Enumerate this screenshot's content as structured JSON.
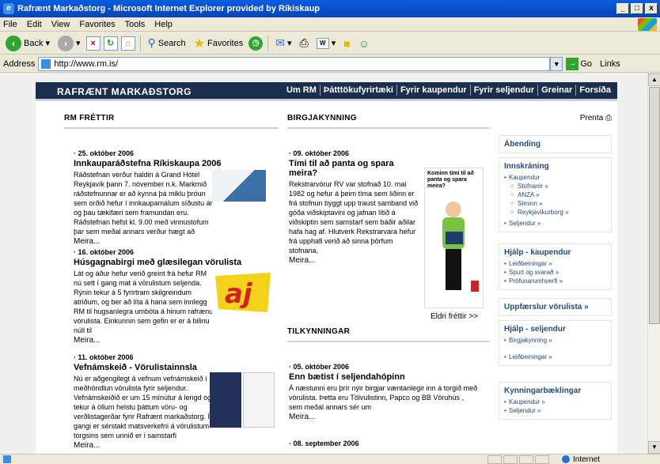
{
  "window": {
    "title": "Rafrænt Markaðstorg - Microsoft Internet Explorer provided by Ríkiskaup"
  },
  "menus": [
    "File",
    "Edit",
    "View",
    "Favorites",
    "Tools",
    "Help"
  ],
  "toolbar": {
    "back": "Back",
    "search": "Search",
    "favorites": "Favorites"
  },
  "address": {
    "label": "Address",
    "url": "http://www.rm.is/",
    "go": "Go",
    "links": "Links"
  },
  "status": {
    "zone": "Internet"
  },
  "site": {
    "name": "RAFRÆNT MARKAÐSTORG",
    "nav": [
      "Um RM",
      "Þátttökufyrirtæki",
      "Fyrir kaupendur",
      "Fyrir seljendur",
      "Greinar",
      "Forsíða"
    ]
  },
  "news": {
    "heading": "RM FRÉTTIR",
    "items": [
      {
        "date": "· 25. október 2006",
        "title": "Innkauparáðstefna Ríkiskaupa 2006",
        "body": "Ráðstefnan verður haldin á Grand Hótel Reykjavík þann 7. nóvember n.k. Markmið ráðstefnunnar er að kynna þá miklu þróun sem orðið hefur í innkaupamálum síðustu ár og þau tækifæri sem framundan eru. Ráðstefnan hefst kl. 9.00 með vinnustofum þar sem meðal annars verður hægt að",
        "more": "Meira..."
      },
      {
        "date": "· 16. október 2006",
        "title": "Húsgagnabirgi með glæsilegan vörulista",
        "body": "Lát og áður hefur verið greint frá hefur RM nú sett í gang mat á vörulistum seljenda. Rýnin tekur á 5 fyrirtram skilgreindum atriðum, og ber að líta á hana sem innlegg RM til hugsanlegra umbóta á hinum rafrænu vörulista. Einkunnin sem gefin er er á bilinu núll til",
        "more": "Meira..."
      },
      {
        "date": "· 11. október 2006",
        "title": "Vefnámskeið - Vörulistainnsla",
        "body": "Nú er aðgengilegt á vefnum vefnámskeið í meðhöndlun vörulista fyrir seljendur. Vefnámskeiðið er um 15 mínútur á lengd og tekur á öllum helstu þáttum vöru- og verðlistagerðar fyrir Rafrænt markaðstorg. Í gangi er sérstakt matsverkefni á vörulistum torgsins sem unnið er í samstarfi",
        "more": "Meira..."
      }
    ]
  },
  "birgja": {
    "heading": "BIRGJAKYNNING",
    "date": "· 09. október 2006",
    "title": "Tími til að panta og spara meira?",
    "body": "Rekstrarvörur RV var stofnað 10. maí 1982 og hefur á þeim tíma sem liðinn er frá stofnun byggt upp traust samband við góða viðskiptavini og jafnan lítið á viðskiptin sem samstarf sem báðir aðilar hafa hag af. Hlutverk Rekstrarvara hefur frá upphafi verið að sinna þörfum stofnana,",
    "more": "Meira...",
    "ad_text": "Kominn tími til að panta og spara meira?",
    "older": "Eldri fréttir >>"
  },
  "tilkynningar": {
    "heading": "TILKYNNINGAR",
    "items": [
      {
        "date": "· 05. október 2006",
        "title": "Enn bætist í seljendahópinn",
        "body": "Á næstunni eru þrír nýir birgjar væntanlegir inn á torgið með vörulista. Þetta eru Tölvulistinn, Papco og BB Vöruhús , sem meðal annars sér um",
        "more": "Meira..."
      },
      {
        "date": "· 08. september 2006"
      }
    ]
  },
  "sidebar": {
    "print": "Prenta",
    "abending": "Ábending",
    "innskraning": {
      "head": "Innskráning",
      "kaupendur": "Kaupendur",
      "sub": [
        "Stofnanir »",
        "ANZA »",
        "Síminn »",
        "Reykjavíkurborg »"
      ],
      "seljendur": "Seljendur »"
    },
    "hjalp_kaup": {
      "head": "Hjálp - kaupendur",
      "items": [
        "Leiðbeiningar »",
        "Spurt og svarað »",
        "Prófunarumhverfi »"
      ]
    },
    "uppfaersla": "Uppfærslur vörulista »",
    "hjalp_selj": {
      "head": "Hjálp - seljendur",
      "items": [
        "Birgjakynning »",
        "Leiðbeiningar »"
      ]
    },
    "kynning": {
      "head": "Kynningarbæklingar",
      "items": [
        "Kaupendur »",
        "Seljendur »"
      ]
    }
  }
}
